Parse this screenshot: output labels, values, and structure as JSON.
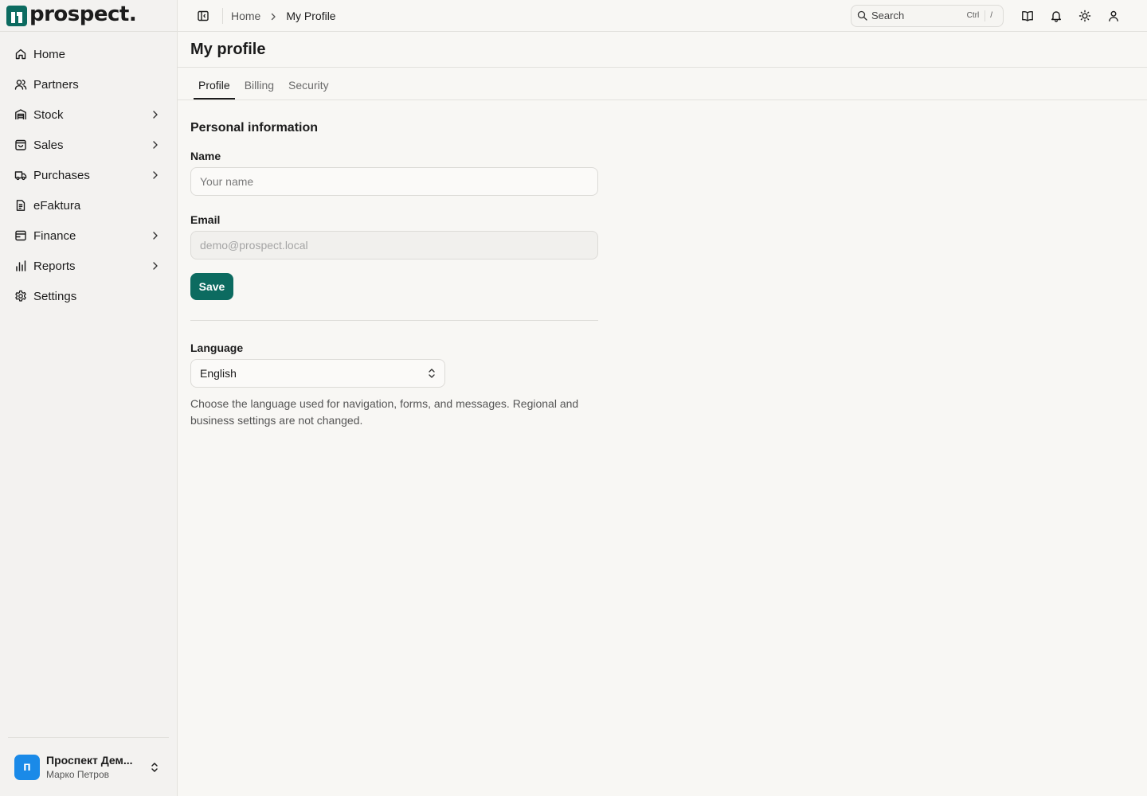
{
  "brand": {
    "name": "prospect."
  },
  "sidebar": {
    "items": [
      {
        "label": "Home",
        "icon": "home-icon",
        "expandable": false
      },
      {
        "label": "Partners",
        "icon": "users-icon",
        "expandable": false
      },
      {
        "label": "Stock",
        "icon": "warehouse-icon",
        "expandable": true
      },
      {
        "label": "Sales",
        "icon": "shopping-bag-icon",
        "expandable": true
      },
      {
        "label": "Purchases",
        "icon": "truck-icon",
        "expandable": true
      },
      {
        "label": "eFaktura",
        "icon": "document-icon",
        "expandable": false
      },
      {
        "label": "Finance",
        "icon": "wallet-icon",
        "expandable": true
      },
      {
        "label": "Reports",
        "icon": "bar-chart-icon",
        "expandable": true
      },
      {
        "label": "Settings",
        "icon": "gear-icon",
        "expandable": false
      }
    ],
    "footer": {
      "avatar_letter": "п",
      "org_name": "Проспект Дем...",
      "user_name": "Марко Петров"
    }
  },
  "topbar": {
    "breadcrumb": {
      "home": "Home",
      "current": "My Profile"
    },
    "search": {
      "placeholder": "Search",
      "shortcut_mod": "Ctrl",
      "shortcut_key": "/"
    }
  },
  "page": {
    "title": "My profile"
  },
  "tabs": [
    {
      "label": "Profile",
      "active": true
    },
    {
      "label": "Billing",
      "active": false
    },
    {
      "label": "Security",
      "active": false
    }
  ],
  "form": {
    "section_title": "Personal information",
    "name": {
      "label": "Name",
      "placeholder": "Your name",
      "value": ""
    },
    "email": {
      "label": "Email",
      "value": "demo@prospect.local"
    },
    "save_label": "Save",
    "language": {
      "label": "Language",
      "value": "English",
      "help": "Choose the language used for navigation, forms, and messages. Regional and business settings are not changed."
    }
  },
  "colors": {
    "accent": "#0c6b60",
    "avatar": "#1a8ae8",
    "background": "#f8f7f4",
    "sidebar_bg": "#f3f2f0"
  }
}
